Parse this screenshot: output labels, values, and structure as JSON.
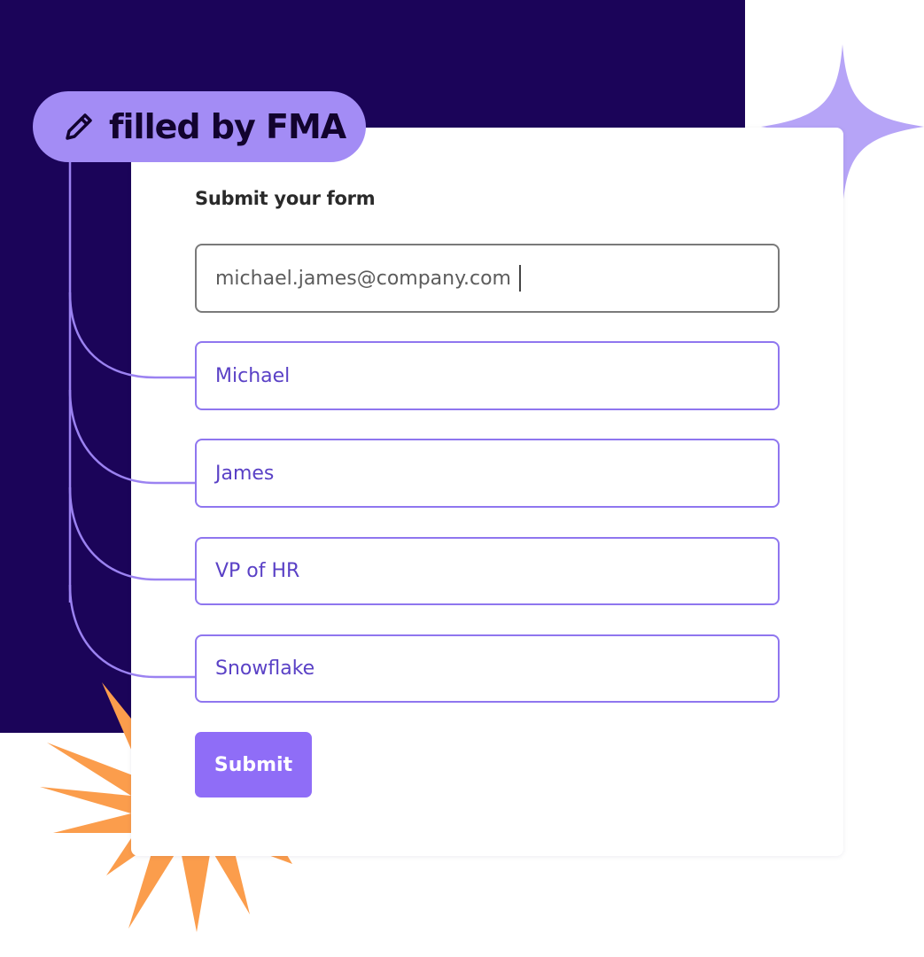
{
  "badge": {
    "label": "filled by FMA",
    "icon": "pencil-icon"
  },
  "form": {
    "title": "Submit your form",
    "email_value": "michael.james@company.com",
    "fields": [
      {
        "value": "Michael"
      },
      {
        "value": "James"
      },
      {
        "value": "VP of HR"
      },
      {
        "value": "Snowflake"
      }
    ],
    "submit_label": "Submit"
  },
  "colors": {
    "background_dark": "#1b0459",
    "accent_purple": "#a38cf5",
    "field_border": "#8f76ef",
    "field_text": "#5a41c6",
    "button": "#8f6df7",
    "burst_orange": "#fb9d4c",
    "sparkle": "#b6a4f7"
  }
}
